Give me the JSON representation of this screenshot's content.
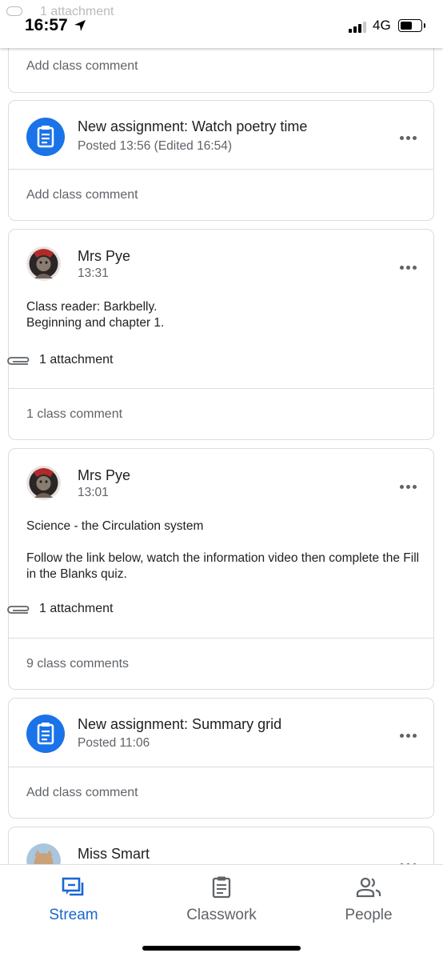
{
  "status_bar": {
    "overlay_text": "1 attachment",
    "time": "16:57",
    "network": "4G"
  },
  "feed": {
    "card0": {
      "comment_label": "Add class comment"
    },
    "card1": {
      "title": "New assignment: Watch  poetry time",
      "meta": "Posted 13:56 (Edited 16:54)",
      "comment_label": "Add class comment"
    },
    "card2": {
      "author": "Mrs Pye",
      "time": "13:31",
      "body_line1": "Class reader: Barkbelly.",
      "body_line2": "Beginning and chapter 1.",
      "attachment": "1 attachment",
      "comment_label": "1 class comment"
    },
    "card3": {
      "author": "Mrs Pye",
      "time": "13:01",
      "body_line1": "Science - the Circulation system",
      "body_line2": "Follow the link below, watch the information video then complete the Fill in the Blanks quiz.",
      "attachment": "1 attachment",
      "comment_label": "9 class comments"
    },
    "card4": {
      "title": "New assignment: Summary grid",
      "meta": "Posted 11:06",
      "comment_label": "Add class comment"
    },
    "card5": {
      "author": "Miss Smart"
    }
  },
  "bottom_nav": {
    "stream": "Stream",
    "classwork": "Classwork",
    "people": "People"
  },
  "colors": {
    "accent": "#1967d2",
    "assignment_icon_bg": "#1a73e8",
    "muted_text": "#5f6368",
    "border": "#dadce0"
  },
  "icons": [
    "location-arrow-icon",
    "signal-icon",
    "battery-icon",
    "assignment-icon",
    "more-options-icon",
    "paperclip-icon",
    "stream-icon",
    "classwork-icon",
    "people-icon"
  ]
}
